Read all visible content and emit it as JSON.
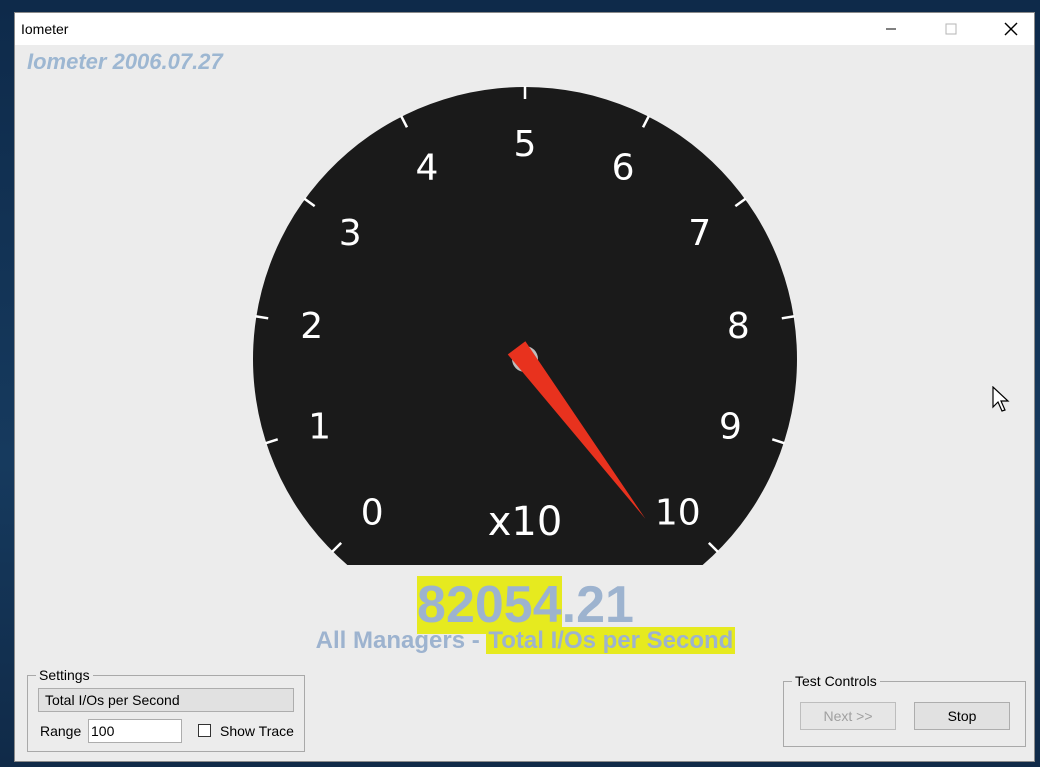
{
  "window": {
    "title": "Iometer",
    "minimize_icon": "minimize-icon",
    "maximize_icon": "maximize-icon",
    "close_icon": "close-icon"
  },
  "header": {
    "version": "Iometer 2006.07.27"
  },
  "gauge": {
    "ticks": [
      "0",
      "1",
      "2",
      "3",
      "4",
      "5",
      "6",
      "7",
      "8",
      "9",
      "10"
    ],
    "multiplier": "x10",
    "needle_value": 10,
    "scale_max": 10,
    "face_color": "#1a1a1a",
    "needle_color": "#e8321e"
  },
  "reading": {
    "value_highlighted": "82054",
    "value_rest": ".21"
  },
  "caption": {
    "prefix": "All Managers - ",
    "metric": "Total I/Os per Second",
    "highlight_color": "#e6ea1f"
  },
  "settings": {
    "group_label": "Settings",
    "metric_selected": "Total I/Os per Second",
    "range_label": "Range",
    "range_value": "100",
    "show_trace_label": "Show Trace",
    "show_trace_checked": false
  },
  "controls": {
    "group_label": "Test Controls",
    "next_label": "Next >>",
    "next_enabled": false,
    "stop_label": "Stop"
  }
}
